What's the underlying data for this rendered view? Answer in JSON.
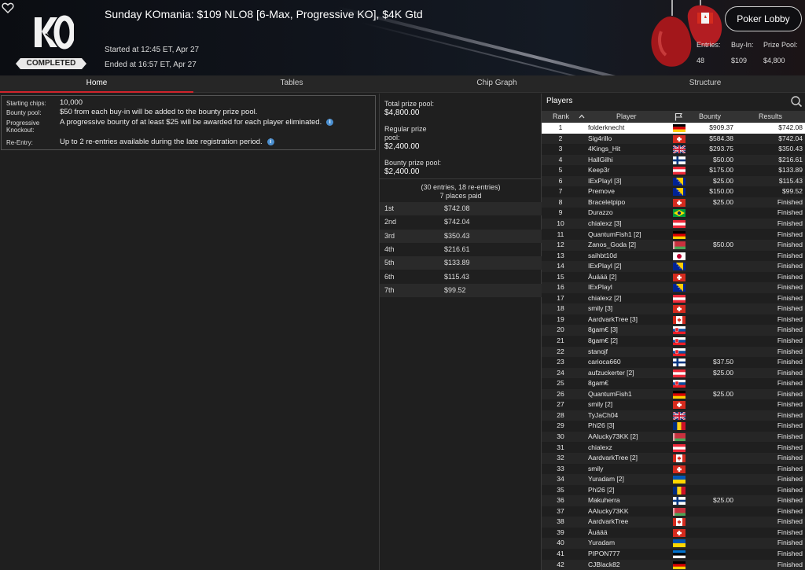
{
  "header": {
    "title": "Sunday KOmania: $109 NLO8 [6-Max, Progressive KO], $4K Gtd",
    "logo_text": "KO",
    "status_badge": "COMPLETED",
    "started": "Started at 12:45 ET, Apr 27",
    "ended": "Ended at 16:57 ET, Apr 27",
    "lobby_button": "Poker Lobby",
    "entries_label": "Entries:",
    "entries_value": "48",
    "buyin_label": "Buy-In:",
    "buyin_value": "$109",
    "prizepool_label": "Prize Pool:",
    "prizepool_value": "$4,800"
  },
  "tabs": [
    "Home",
    "Tables",
    "Chip Graph",
    "Structure"
  ],
  "info": {
    "starting_chips_label": "Starting chips:",
    "starting_chips_value": "10,000",
    "bounty_pool_label": "Bounty pool:",
    "bounty_pool_value": "$50 from each buy-in will be added to the bounty prize pool.",
    "progressive_label": "Progressive Knockout:",
    "progressive_value": "A progressive bounty of at least $25 will be awarded for each player eliminated.",
    "reentry_label": "Re-Entry:",
    "reentry_value": "Up to 2 re-entries available during the late registration period."
  },
  "prize": {
    "total_label": "Total prize pool:",
    "total_value": "$4,800.00",
    "regular_label": "Regular prize pool:",
    "regular_value": "$2,400.00",
    "bounty_label": "Bounty prize pool:",
    "bounty_value": "$2,400.00",
    "entries_line": "(30 entries, 18 re-entries)",
    "paid_line": "7 places paid",
    "places": [
      {
        "place": "1st",
        "amount": "$742.08"
      },
      {
        "place": "2nd",
        "amount": "$742.04"
      },
      {
        "place": "3rd",
        "amount": "$350.43"
      },
      {
        "place": "4th",
        "amount": "$216.61"
      },
      {
        "place": "5th",
        "amount": "$133.89"
      },
      {
        "place": "6th",
        "amount": "$115.43"
      },
      {
        "place": "7th",
        "amount": "$99.52"
      }
    ]
  },
  "players": {
    "title": "Players",
    "columns": {
      "rank": "Rank",
      "player": "Player",
      "bounty": "Bounty",
      "results": "Results"
    },
    "rows": [
      {
        "rank": "1",
        "name": "folderknecht",
        "flag": "de",
        "bounty": "$909.37",
        "result": "$742.08"
      },
      {
        "rank": "2",
        "name": "Sig4rillo",
        "flag": "ch",
        "bounty": "$584.38",
        "result": "$742.04"
      },
      {
        "rank": "3",
        "name": "4Kings_Hit",
        "flag": "gb",
        "bounty": "$293.75",
        "result": "$350.43"
      },
      {
        "rank": "4",
        "name": "HallGilhi",
        "flag": "fi",
        "bounty": "$50.00",
        "result": "$216.61"
      },
      {
        "rank": "5",
        "name": "Keep3r",
        "flag": "at",
        "bounty": "$175.00",
        "result": "$133.89"
      },
      {
        "rank": "6",
        "name": "IExPlayl [3]",
        "flag": "ba",
        "bounty": "$25.00",
        "result": "$115.43"
      },
      {
        "rank": "7",
        "name": "Premove",
        "flag": "ba",
        "bounty": "$150.00",
        "result": "$99.52"
      },
      {
        "rank": "8",
        "name": "Braceletpipo",
        "flag": "ch",
        "bounty": "$25.00",
        "result": "Finished"
      },
      {
        "rank": "9",
        "name": "Durazzo",
        "flag": "br",
        "bounty": "",
        "result": "Finished"
      },
      {
        "rank": "10",
        "name": "chialexz [3]",
        "flag": "at",
        "bounty": "",
        "result": "Finished"
      },
      {
        "rank": "11",
        "name": "QuantumFish1 [2]",
        "flag": "de",
        "bounty": "",
        "result": "Finished"
      },
      {
        "rank": "12",
        "name": "Zanos_Goda [2]",
        "flag": "by",
        "bounty": "$50.00",
        "result": "Finished"
      },
      {
        "rank": "13",
        "name": "saihbt10d",
        "flag": "jp",
        "bounty": "",
        "result": "Finished"
      },
      {
        "rank": "14",
        "name": "IExPlayl [2]",
        "flag": "ba",
        "bounty": "",
        "result": "Finished"
      },
      {
        "rank": "15",
        "name": "Äuäää [2]",
        "flag": "ch",
        "bounty": "",
        "result": "Finished"
      },
      {
        "rank": "16",
        "name": "IExPlayl",
        "flag": "ba",
        "bounty": "",
        "result": "Finished"
      },
      {
        "rank": "17",
        "name": "chialexz [2]",
        "flag": "at",
        "bounty": "",
        "result": "Finished"
      },
      {
        "rank": "18",
        "name": "smily [3]",
        "flag": "ch",
        "bounty": "",
        "result": "Finished"
      },
      {
        "rank": "19",
        "name": "AardvarkTree [3]",
        "flag": "ca",
        "bounty": "",
        "result": "Finished"
      },
      {
        "rank": "20",
        "name": "8gam€ [3]",
        "flag": "sk",
        "bounty": "",
        "result": "Finished"
      },
      {
        "rank": "21",
        "name": "8gam€ [2]",
        "flag": "sk",
        "bounty": "",
        "result": "Finished"
      },
      {
        "rank": "22",
        "name": "stanojf",
        "flag": "sk",
        "bounty": "",
        "result": "Finished"
      },
      {
        "rank": "23",
        "name": "carioca660",
        "flag": "fi",
        "bounty": "$37.50",
        "result": "Finished"
      },
      {
        "rank": "24",
        "name": "aufzuckerter [2]",
        "flag": "at",
        "bounty": "$25.00",
        "result": "Finished"
      },
      {
        "rank": "25",
        "name": "8gam€",
        "flag": "sk",
        "bounty": "",
        "result": "Finished"
      },
      {
        "rank": "26",
        "name": "QuantumFish1",
        "flag": "de",
        "bounty": "$25.00",
        "result": "Finished"
      },
      {
        "rank": "27",
        "name": "smily [2]",
        "flag": "ch",
        "bounty": "",
        "result": "Finished"
      },
      {
        "rank": "28",
        "name": "TyJaCh04",
        "flag": "gb",
        "bounty": "",
        "result": "Finished"
      },
      {
        "rank": "29",
        "name": "Phl26 [3]",
        "flag": "ro",
        "bounty": "",
        "result": "Finished"
      },
      {
        "rank": "30",
        "name": "AAlucky73KK [2]",
        "flag": "by",
        "bounty": "",
        "result": "Finished"
      },
      {
        "rank": "31",
        "name": "chialexz",
        "flag": "at",
        "bounty": "",
        "result": "Finished"
      },
      {
        "rank": "32",
        "name": "AardvarkTree [2]",
        "flag": "ca",
        "bounty": "",
        "result": "Finished"
      },
      {
        "rank": "33",
        "name": "smily",
        "flag": "ch",
        "bounty": "",
        "result": "Finished"
      },
      {
        "rank": "34",
        "name": "Yuradam [2]",
        "flag": "ua",
        "bounty": "",
        "result": "Finished"
      },
      {
        "rank": "35",
        "name": "Phl26 [2]",
        "flag": "ro",
        "bounty": "",
        "result": "Finished"
      },
      {
        "rank": "36",
        "name": "Makuherra",
        "flag": "fi",
        "bounty": "$25.00",
        "result": "Finished"
      },
      {
        "rank": "37",
        "name": "AAlucky73KK",
        "flag": "by",
        "bounty": "",
        "result": "Finished"
      },
      {
        "rank": "38",
        "name": "AardvarkTree",
        "flag": "ca",
        "bounty": "",
        "result": "Finished"
      },
      {
        "rank": "39",
        "name": "Äuäää",
        "flag": "ch",
        "bounty": "",
        "result": "Finished"
      },
      {
        "rank": "40",
        "name": "Yuradam",
        "flag": "ua",
        "bounty": "",
        "result": "Finished"
      },
      {
        "rank": "41",
        "name": "PIPON777",
        "flag": "ee",
        "bounty": "",
        "result": "Finished"
      },
      {
        "rank": "42",
        "name": "CJBlack82",
        "flag": "de",
        "bounty": "",
        "result": "Finished"
      }
    ]
  }
}
